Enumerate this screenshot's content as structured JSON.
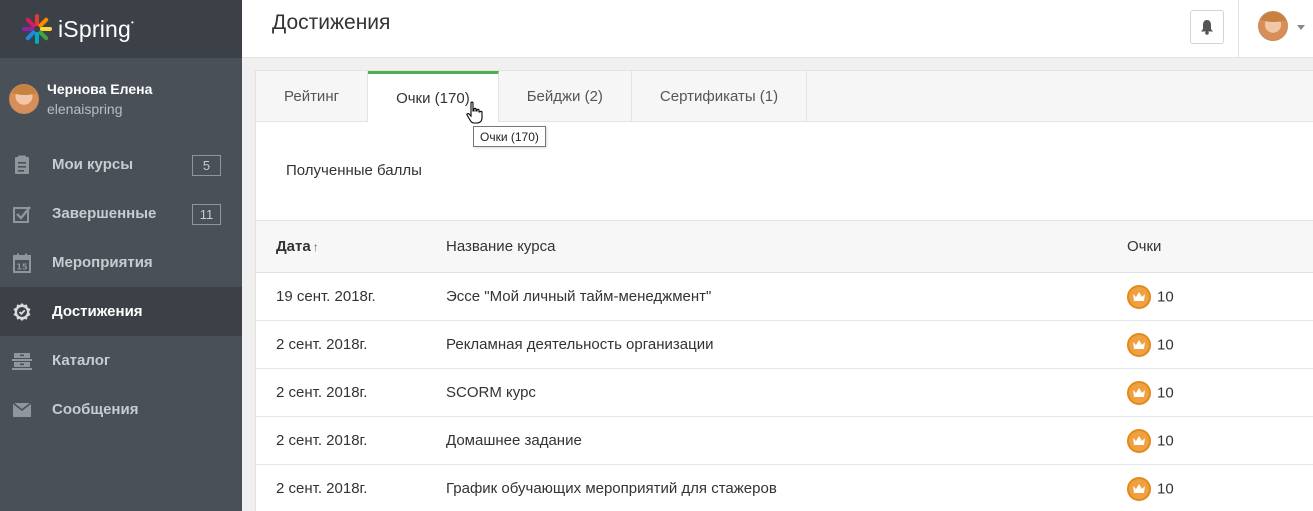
{
  "app": {
    "logo_text": "iSpring"
  },
  "user": {
    "name": "Чернова Елена",
    "login": "elenaispring"
  },
  "sidebar": {
    "items": [
      {
        "label": "Мои курсы",
        "count": "5",
        "icon": "courses-icon"
      },
      {
        "label": "Завершенные",
        "count": "11",
        "icon": "checkbox-icon"
      },
      {
        "label": "Мероприятия",
        "count": "",
        "icon": "calendar-icon"
      },
      {
        "label": "Достижения",
        "count": "",
        "icon": "achievement-icon",
        "active": true
      },
      {
        "label": "Каталог",
        "count": "",
        "icon": "catalog-icon"
      },
      {
        "label": "Сообщения",
        "count": "",
        "icon": "envelope-icon"
      }
    ]
  },
  "header": {
    "title": "Достижения"
  },
  "tabs": [
    {
      "label": "Рейтинг"
    },
    {
      "label": "Очки (170)",
      "active": true
    },
    {
      "label": "Бейджи (2)"
    },
    {
      "label": "Сертификаты (1)"
    }
  ],
  "tooltip": {
    "text": "Очки (170)"
  },
  "section": {
    "label": "Полученные баллы"
  },
  "table": {
    "columns": [
      "Дата",
      "Название курса",
      "Очки"
    ],
    "rows": [
      {
        "date": "19 сент. 2018г.",
        "course": "Эссе \"Мой личный тайм-менеджмент\"",
        "points": "10"
      },
      {
        "date": "2 сент. 2018г.",
        "course": "Рекламная деятельность организации",
        "points": "10"
      },
      {
        "date": "2 сент. 2018г.",
        "course": "SCORM курс",
        "points": "10"
      },
      {
        "date": "2 сент. 2018г.",
        "course": "Домашнее задание",
        "points": "10"
      },
      {
        "date": "2 сент. 2018г.",
        "course": "График обучающих мероприятий для стажеров",
        "points": "10"
      }
    ]
  },
  "colors": {
    "accent": "#4caf50",
    "sidebar_bg": "#495057",
    "coin": "#f0a040"
  }
}
